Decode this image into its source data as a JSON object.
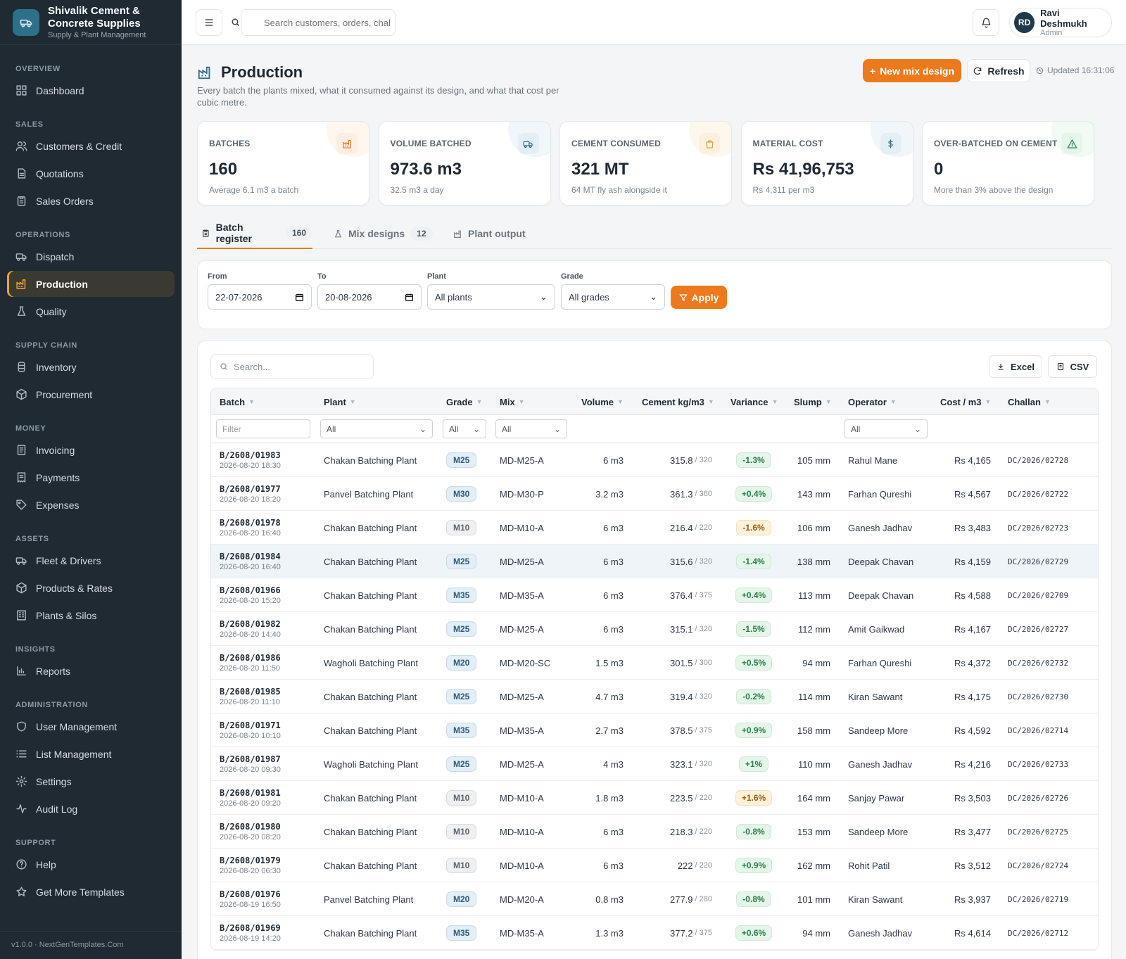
{
  "brand": {
    "name_line1": "Shivalik Cement &",
    "name_line2": "Concrete Supplies",
    "subtitle": "Supply & Plant Management"
  },
  "nav": [
    {
      "group": "Overview",
      "items": [
        {
          "label": "Dashboard",
          "icon": "dashboard-icon"
        }
      ]
    },
    {
      "group": "Sales",
      "items": [
        {
          "label": "Customers & Credit",
          "icon": "users-icon"
        },
        {
          "label": "Quotations",
          "icon": "document-icon"
        },
        {
          "label": "Sales Orders",
          "icon": "clipboard-icon"
        }
      ]
    },
    {
      "group": "Operations",
      "items": [
        {
          "label": "Dispatch",
          "icon": "truck-icon"
        },
        {
          "label": "Production",
          "icon": "factory-icon",
          "active": true
        },
        {
          "label": "Quality",
          "icon": "flask-icon"
        }
      ]
    },
    {
      "group": "Supply Chain",
      "items": [
        {
          "label": "Inventory",
          "icon": "silo-icon"
        },
        {
          "label": "Procurement",
          "icon": "box-icon"
        }
      ]
    },
    {
      "group": "Money",
      "items": [
        {
          "label": "Invoicing",
          "icon": "invoice-icon"
        },
        {
          "label": "Payments",
          "icon": "receipt-icon"
        },
        {
          "label": "Expenses",
          "icon": "tag-icon"
        }
      ]
    },
    {
      "group": "Assets",
      "items": [
        {
          "label": "Fleet & Drivers",
          "icon": "truck-icon"
        },
        {
          "label": "Products & Rates",
          "icon": "box-icon"
        },
        {
          "label": "Plants & Silos",
          "icon": "building-icon"
        }
      ]
    },
    {
      "group": "Insights",
      "items": [
        {
          "label": "Reports",
          "icon": "bar-chart-icon"
        }
      ]
    },
    {
      "group": "Administration",
      "items": [
        {
          "label": "User Management",
          "icon": "shield-icon"
        },
        {
          "label": "List Management",
          "icon": "list-icon"
        },
        {
          "label": "Settings",
          "icon": "gear-icon"
        },
        {
          "label": "Audit Log",
          "icon": "activity-icon"
        }
      ]
    },
    {
      "group": "Support",
      "items": [
        {
          "label": "Help",
          "icon": "help-icon"
        },
        {
          "label": "Get More Templates",
          "icon": "star-icon"
        }
      ]
    }
  ],
  "footer": "v1.0.0 · NextGenTemplates.Com",
  "topbar": {
    "search_placeholder": "Search customers, orders, chal",
    "user_initials": "RD",
    "user_name": "Ravi Deshmukh",
    "user_role": "Admin"
  },
  "page": {
    "title": "Production",
    "description": "Every batch the plants mixed, what it consumed against its design, and what that cost per cubic metre.",
    "new_button": "New mix design",
    "refresh_button": "Refresh",
    "updated": "Updated 16:31:06"
  },
  "kpis": [
    {
      "label": "Batches",
      "value": "160",
      "sub": "Average 6.1 m3 a batch",
      "color": "#ec7a1c",
      "bg": "#fdeee2",
      "icon": "factory-icon"
    },
    {
      "label": "Volume batched",
      "value": "973.6 m3",
      "sub": "32.5 m3 a day",
      "color": "#2e6f8a",
      "bg": "#e4eff5",
      "icon": "truck-icon"
    },
    {
      "label": "Cement consumed",
      "value": "321 MT",
      "sub": "64 MT fly ash alongside it",
      "color": "#d6a23a",
      "bg": "#fbf1de",
      "icon": "bag-icon"
    },
    {
      "label": "Material cost",
      "value": "Rs 41,96,753",
      "sub": "Rs 4,311 per m3",
      "color": "#2e6f8a",
      "bg": "#e4eff5",
      "icon": "dollar-icon"
    },
    {
      "label": "Over-batched on cement",
      "value": "0",
      "sub": "More than 3% above the design",
      "color": "#27834a",
      "bg": "#e6f5ea",
      "icon": "warning-icon"
    }
  ],
  "tabs": [
    {
      "label": "Batch register",
      "count": "160"
    },
    {
      "label": "Mix designs",
      "count": "12"
    },
    {
      "label": "Plant output",
      "count": ""
    }
  ],
  "filters": {
    "from_label": "From",
    "from": "22-07-2026",
    "to_label": "To",
    "to": "20-08-2026",
    "plant_label": "Plant",
    "plant": "All plants",
    "grade_label": "Grade",
    "grade": "All grades",
    "apply": "Apply"
  },
  "table": {
    "search_placeholder": "Search...",
    "excel": "Excel",
    "csv": "CSV",
    "columns": [
      "Batch",
      "Plant",
      "Grade",
      "Mix",
      "Volume",
      "Cement kg/m3",
      "Variance",
      "Slump",
      "Operator",
      "Cost / m3",
      "Challan"
    ],
    "filter_text": "Filter",
    "filter_all": "All",
    "rows": [
      {
        "id": "B/2608/01983",
        "dt": "2026-08-20 18:30",
        "plant": "Chakan Batching Plant",
        "grade": "M25",
        "mix": "MD-M25-A",
        "vol": "6 m3",
        "cem": "315.8",
        "design": "/ 320",
        "var": "-1.3%",
        "vs": "ok",
        "slump": "105 mm",
        "op": "Rahul Mane",
        "cost": "Rs 4,165",
        "ch": "DC/2026/02728"
      },
      {
        "id": "B/2608/01977",
        "dt": "2026-08-20 18:20",
        "plant": "Panvel Batching Plant",
        "grade": "M30",
        "mix": "MD-M30-P",
        "vol": "3.2 m3",
        "cem": "361.3",
        "design": "/ 360",
        "var": "+0.4%",
        "vs": "ok",
        "slump": "143 mm",
        "op": "Farhan Qureshi",
        "cost": "Rs 4,567",
        "ch": "DC/2026/02722"
      },
      {
        "id": "B/2608/01978",
        "dt": "2026-08-20 16:40",
        "plant": "Chakan Batching Plant",
        "grade": "M10",
        "mix": "MD-M10-A",
        "vol": "6 m3",
        "cem": "216.4",
        "design": "/ 220",
        "var": "-1.6%",
        "vs": "warn",
        "slump": "106 mm",
        "op": "Ganesh Jadhav",
        "cost": "Rs 3,483",
        "ch": "DC/2026/02723"
      },
      {
        "id": "B/2608/01984",
        "dt": "2026-08-20 16:40",
        "plant": "Chakan Batching Plant",
        "grade": "M25",
        "mix": "MD-M25-A",
        "vol": "6 m3",
        "cem": "315.6",
        "design": "/ 320",
        "var": "-1.4%",
        "vs": "ok",
        "slump": "138 mm",
        "op": "Deepak Chavan",
        "cost": "Rs 4,159",
        "ch": "DC/2026/02729",
        "hl": true
      },
      {
        "id": "B/2608/01966",
        "dt": "2026-08-20 15:20",
        "plant": "Chakan Batching Plant",
        "grade": "M35",
        "mix": "MD-M35-A",
        "vol": "6 m3",
        "cem": "376.4",
        "design": "/ 375",
        "var": "+0.4%",
        "vs": "ok",
        "slump": "113 mm",
        "op": "Deepak Chavan",
        "cost": "Rs 4,588",
        "ch": "DC/2026/02709"
      },
      {
        "id": "B/2608/01982",
        "dt": "2026-08-20 14:40",
        "plant": "Chakan Batching Plant",
        "grade": "M25",
        "mix": "MD-M25-A",
        "vol": "6 m3",
        "cem": "315.1",
        "design": "/ 320",
        "var": "-1.5%",
        "vs": "ok",
        "slump": "112 mm",
        "op": "Amit Gaikwad",
        "cost": "Rs 4,167",
        "ch": "DC/2026/02727"
      },
      {
        "id": "B/2608/01986",
        "dt": "2026-08-20 11:50",
        "plant": "Wagholi Batching Plant",
        "grade": "M20",
        "mix": "MD-M20-SC",
        "vol": "1.5 m3",
        "cem": "301.5",
        "design": "/ 300",
        "var": "+0.5%",
        "vs": "ok",
        "slump": "94 mm",
        "op": "Farhan Qureshi",
        "cost": "Rs 4,372",
        "ch": "DC/2026/02732"
      },
      {
        "id": "B/2608/01985",
        "dt": "2026-08-20 11:10",
        "plant": "Chakan Batching Plant",
        "grade": "M25",
        "mix": "MD-M25-A",
        "vol": "4.7 m3",
        "cem": "319.4",
        "design": "/ 320",
        "var": "-0.2%",
        "vs": "ok",
        "slump": "114 mm",
        "op": "Kiran Sawant",
        "cost": "Rs 4,175",
        "ch": "DC/2026/02730"
      },
      {
        "id": "B/2608/01971",
        "dt": "2026-08-20 10:10",
        "plant": "Chakan Batching Plant",
        "grade": "M35",
        "mix": "MD-M35-A",
        "vol": "2.7 m3",
        "cem": "378.5",
        "design": "/ 375",
        "var": "+0.9%",
        "vs": "ok",
        "slump": "158 mm",
        "op": "Sandeep More",
        "cost": "Rs 4,592",
        "ch": "DC/2026/02714"
      },
      {
        "id": "B/2608/01987",
        "dt": "2026-08-20 09:30",
        "plant": "Wagholi Batching Plant",
        "grade": "M25",
        "mix": "MD-M25-A",
        "vol": "4 m3",
        "cem": "323.1",
        "design": "/ 320",
        "var": "+1%",
        "vs": "ok",
        "slump": "110 mm",
        "op": "Ganesh Jadhav",
        "cost": "Rs 4,216",
        "ch": "DC/2026/02733"
      },
      {
        "id": "B/2608/01981",
        "dt": "2026-08-20 09:20",
        "plant": "Chakan Batching Plant",
        "grade": "M10",
        "mix": "MD-M10-A",
        "vol": "1.8 m3",
        "cem": "223.5",
        "design": "/ 220",
        "var": "+1.6%",
        "vs": "warn",
        "slump": "164 mm",
        "op": "Sanjay Pawar",
        "cost": "Rs 3,503",
        "ch": "DC/2026/02726"
      },
      {
        "id": "B/2608/01980",
        "dt": "2026-08-20 08:20",
        "plant": "Chakan Batching Plant",
        "grade": "M10",
        "mix": "MD-M10-A",
        "vol": "6 m3",
        "cem": "218.3",
        "design": "/ 220",
        "var": "-0.8%",
        "vs": "ok",
        "slump": "153 mm",
        "op": "Sandeep More",
        "cost": "Rs 3,477",
        "ch": "DC/2026/02725"
      },
      {
        "id": "B/2608/01979",
        "dt": "2026-08-20 06:30",
        "plant": "Chakan Batching Plant",
        "grade": "M10",
        "mix": "MD-M10-A",
        "vol": "6 m3",
        "cem": "222",
        "design": "/ 220",
        "var": "+0.9%",
        "vs": "ok",
        "slump": "162 mm",
        "op": "Rohit Patil",
        "cost": "Rs 3,512",
        "ch": "DC/2026/02724"
      },
      {
        "id": "B/2608/01976",
        "dt": "2026-08-19 16:50",
        "plant": "Panvel Batching Plant",
        "grade": "M20",
        "mix": "MD-M20-A",
        "vol": "0.8 m3",
        "cem": "277.9",
        "design": "/ 280",
        "var": "-0.8%",
        "vs": "ok",
        "slump": "101 mm",
        "op": "Kiran Sawant",
        "cost": "Rs 3,937",
        "ch": "DC/2026/02719"
      },
      {
        "id": "B/2608/01969",
        "dt": "2026-08-19 14:20",
        "plant": "Chakan Batching Plant",
        "grade": "M35",
        "mix": "MD-M35-A",
        "vol": "1.3 m3",
        "cem": "377.2",
        "design": "/ 375",
        "var": "+0.6%",
        "vs": "ok",
        "slump": "94 mm",
        "op": "Ganesh Jadhav",
        "cost": "Rs 4,614",
        "ch": "DC/2026/02712"
      }
    ]
  }
}
